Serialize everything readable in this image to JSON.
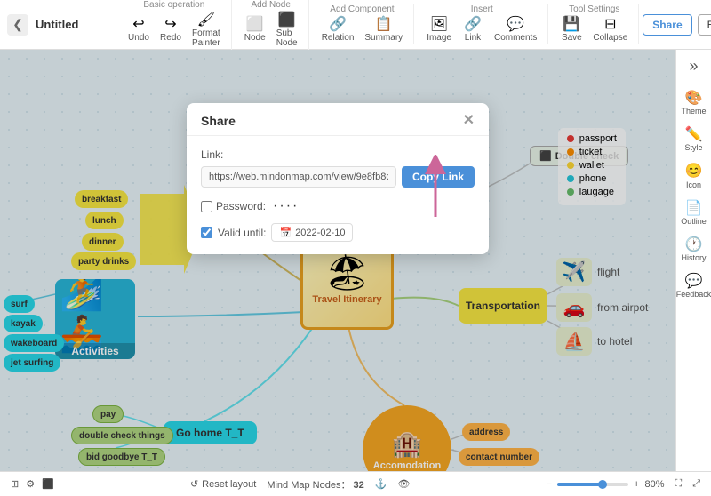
{
  "app": {
    "title": "Untitled"
  },
  "toolbar": {
    "basic_operation": "Basic operation",
    "undo": "Undo",
    "redo": "Redo",
    "format_painter": "Format Painter",
    "add_node": "Add Node",
    "node": "Node",
    "sub_node": "Sub Node",
    "add_component": "Add Component",
    "relation": "Relation",
    "summary": "Summary",
    "insert": "Insert",
    "image": "Image",
    "link": "Link",
    "comments": "Comments",
    "tool_settings": "Tool Settings",
    "save": "Save",
    "collapse": "Collapse",
    "share": "Share",
    "export": "Export"
  },
  "right_sidebar": {
    "theme": "Theme",
    "style": "Style",
    "icon": "Icon",
    "outline": "Outline",
    "history": "History",
    "feedback": "Feedback"
  },
  "share_modal": {
    "title": "Share",
    "link_label": "Link:",
    "link_url": "https://web.mindonmap.com/view/9e8fb8c3f50c917",
    "copy_link": "Copy Link",
    "password_label": "Password:",
    "password_value": "····",
    "valid_until_label": "Valid until:",
    "valid_date": "2022-02-10"
  },
  "mind_map": {
    "central_label": "Travel Itinerary",
    "activities": {
      "label": "Activities",
      "items": [
        "surf",
        "kayak",
        "wakeboard",
        "jet surfing"
      ]
    },
    "meals": [
      "breakfast",
      "lunch",
      "dinner",
      "party drinks"
    ],
    "transport": {
      "label": "Transportation",
      "items": [
        "flight",
        "from airpot",
        "to hotel"
      ]
    },
    "accommodation": {
      "label": "Accomodation",
      "items": [
        "address",
        "contact number"
      ]
    },
    "go_home": {
      "label": "Go home T_T",
      "items": [
        "pay",
        "double check things",
        "bid goodbye T_T"
      ]
    },
    "double_check": {
      "label": "Double check",
      "items": [
        "passport",
        "ticket",
        "wallet",
        "phone",
        "laugage"
      ]
    }
  },
  "bottom_bar": {
    "reset_layout": "Reset layout",
    "mind_map_nodes": "Mind Map Nodes：",
    "node_count": "32",
    "zoom": "80%"
  }
}
